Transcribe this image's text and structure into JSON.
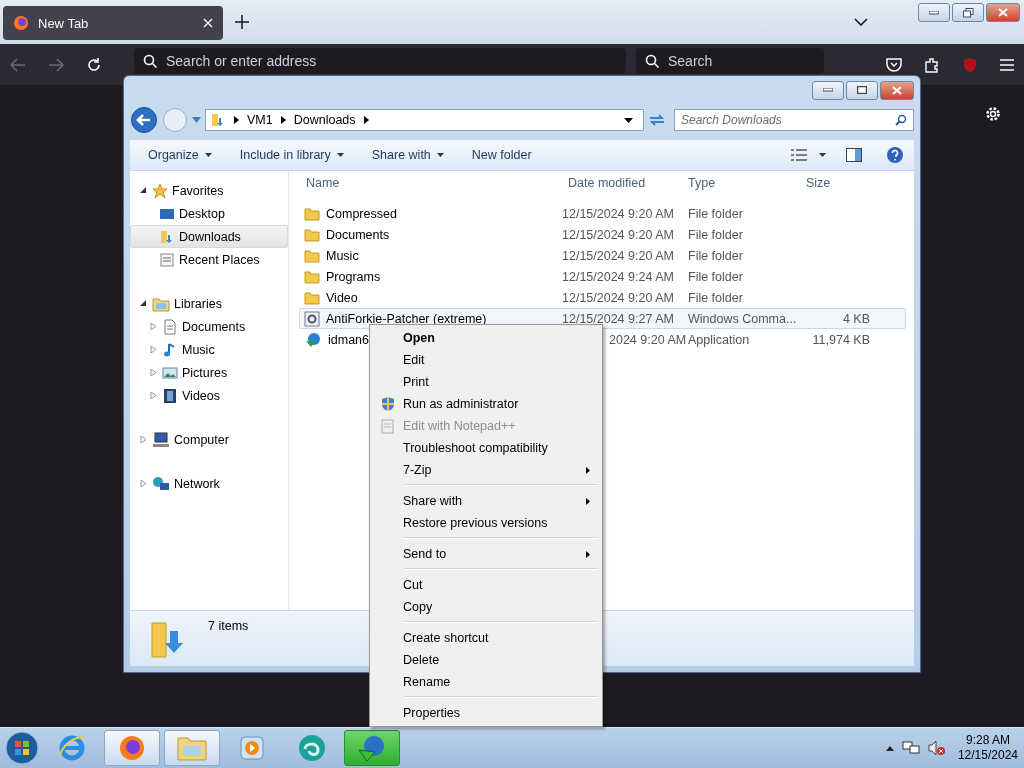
{
  "browser": {
    "tab": {
      "title": "New Tab"
    },
    "address": {
      "placeholder": "Search or enter address"
    },
    "search": {
      "placeholder": "Search"
    }
  },
  "explorer": {
    "breadcrumb": [
      "VM1",
      "Downloads"
    ],
    "search": {
      "placeholder": "Search Downloads"
    },
    "toolbar": [
      {
        "label": "Organize",
        "dropdown": true
      },
      {
        "label": "Include in library",
        "dropdown": true
      },
      {
        "label": "Share with",
        "dropdown": true
      },
      {
        "label": "New folder",
        "dropdown": false
      }
    ],
    "nav": [
      {
        "label": "Favorites",
        "kind": "star",
        "expanded": true,
        "children": [
          {
            "label": "Desktop",
            "kind": "desktop",
            "selected": false
          },
          {
            "label": "Downloads",
            "kind": "downloads",
            "selected": true
          },
          {
            "label": "Recent Places",
            "kind": "recent",
            "selected": false
          }
        ]
      },
      {
        "label": "Libraries",
        "kind": "library",
        "expanded": true,
        "children": [
          {
            "label": "Documents",
            "kind": "documents",
            "expanded": false,
            "selected": false
          },
          {
            "label": "Music",
            "kind": "music",
            "expanded": false,
            "selected": false
          },
          {
            "label": "Pictures",
            "kind": "pictures",
            "expanded": false,
            "selected": false
          },
          {
            "label": "Videos",
            "kind": "videos",
            "expanded": false,
            "selected": false
          }
        ]
      },
      {
        "label": "Computer",
        "kind": "computer",
        "expanded": false
      },
      {
        "label": "Network",
        "kind": "network",
        "expanded": false
      }
    ],
    "columns": [
      "Name",
      "Date modified",
      "Type",
      "Size"
    ],
    "rows": [
      {
        "name": "Compressed",
        "date": "12/15/2024 9:20 AM",
        "type": "File folder",
        "kind": "folder",
        "selected": false,
        "covered": false
      },
      {
        "name": "Documents",
        "date": "12/15/2024 9:20 AM",
        "type": "File folder",
        "kind": "folder",
        "selected": false,
        "covered": false
      },
      {
        "name": "Music",
        "date": "12/15/2024 9:20 AM",
        "type": "File folder",
        "kind": "folder",
        "selected": false,
        "covered": false
      },
      {
        "name": "Programs",
        "date": "12/15/2024 9:24 AM",
        "type": "File folder",
        "kind": "folder",
        "selected": false,
        "covered": false
      },
      {
        "name": "Video",
        "date": "12/15/2024 9:20 AM",
        "type": "File folder",
        "kind": "folder",
        "selected": false,
        "covered": false
      },
      {
        "name": "AntiForkie-Patcher (extreme)",
        "date": "12/15/2024 9:27 AM",
        "type": "Windows Comma...",
        "size": "4 KB",
        "kind": "script",
        "selected": true,
        "covered": false
      },
      {
        "name": "idman6",
        "date": "2024 9:20 AM",
        "type": "Application",
        "size": "11,974 KB",
        "kind": "app",
        "selected": false,
        "covered": true
      }
    ],
    "status": "7 items"
  },
  "context_menu": [
    {
      "kind": "item",
      "label": "Open",
      "bold": true,
      "disabled": false,
      "submenu": false
    },
    {
      "kind": "item",
      "label": "Edit",
      "bold": false,
      "disabled": false,
      "submenu": false
    },
    {
      "kind": "item",
      "label": "Print",
      "bold": false,
      "disabled": false,
      "submenu": false
    },
    {
      "kind": "shield",
      "label": "Run as administrator",
      "bold": false,
      "disabled": false,
      "submenu": false
    },
    {
      "kind": "notepad",
      "label": "Edit with Notepad++",
      "bold": false,
      "disabled": true,
      "submenu": false
    },
    {
      "kind": "item",
      "label": "Troubleshoot compatibility",
      "bold": false,
      "disabled": false,
      "submenu": false
    },
    {
      "kind": "item",
      "label": "7-Zip",
      "bold": false,
      "disabled": false,
      "submenu": true
    },
    {
      "kind": "separator"
    },
    {
      "kind": "item",
      "label": "Share with",
      "bold": false,
      "disabled": false,
      "submenu": true
    },
    {
      "kind": "item",
      "label": "Restore previous versions",
      "bold": false,
      "disabled": false,
      "submenu": false
    },
    {
      "kind": "separator"
    },
    {
      "kind": "item",
      "label": "Send to",
      "bold": false,
      "disabled": false,
      "submenu": true
    },
    {
      "kind": "separator"
    },
    {
      "kind": "item",
      "label": "Cut",
      "bold": false,
      "disabled": false,
      "submenu": false
    },
    {
      "kind": "item",
      "label": "Copy",
      "bold": false,
      "disabled": false,
      "submenu": false
    },
    {
      "kind": "separator"
    },
    {
      "kind": "item",
      "label": "Create shortcut",
      "bold": false,
      "disabled": false,
      "submenu": false
    },
    {
      "kind": "item",
      "label": "Delete",
      "bold": false,
      "disabled": false,
      "submenu": false
    },
    {
      "kind": "item",
      "label": "Rename",
      "bold": false,
      "disabled": false,
      "submenu": false
    },
    {
      "kind": "separator"
    },
    {
      "kind": "item",
      "label": "Properties",
      "bold": false,
      "disabled": false,
      "submenu": false
    }
  ],
  "taskbar": {
    "apps": [
      {
        "kind": "ie",
        "running": false,
        "flashing": false
      },
      {
        "kind": "firefox",
        "running": true,
        "flashing": false
      },
      {
        "kind": "explorer",
        "running": true,
        "flashing": false
      },
      {
        "kind": "media",
        "running": false,
        "flashing": false
      },
      {
        "kind": "spiral",
        "running": false,
        "flashing": false
      },
      {
        "kind": "idm",
        "running": true,
        "flashing": true
      }
    ],
    "clock": {
      "time": "9:28 AM",
      "date": "12/15/2024"
    }
  }
}
